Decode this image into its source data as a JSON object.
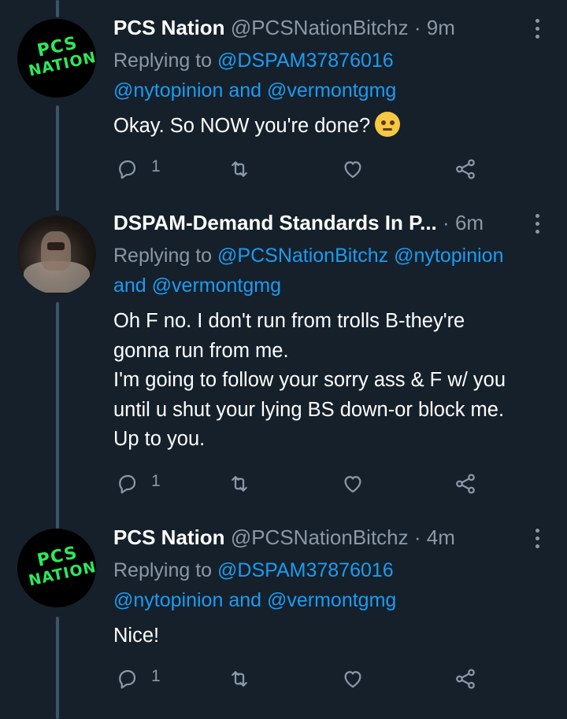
{
  "tweets": [
    {
      "name": "PCS Nation",
      "handle": "@PCSNationBitchz",
      "dot": "·",
      "time": "9m",
      "avatar_text": [
        "PCS",
        "NATION"
      ],
      "replying_prefix": "Replying to",
      "replying_mention1": "@DSPAM37876016",
      "replying_mention2": "@nytopinion",
      "replying_and": "and",
      "replying_mention3": "@vermontgmg",
      "text": "Okay. So NOW you're done?",
      "emoji": "rolling-eyes-emoji",
      "reply_count": "1"
    },
    {
      "name": "DSPAM-Demand Standards In P...",
      "dot": "·",
      "time": "6m",
      "replying_prefix": "Replying to",
      "replying_mention1": "@PCSNationBitchz",
      "replying_mention2": "@nytopinion",
      "replying_and": "and",
      "replying_mention3": "@vermontgmg",
      "text_lines": [
        "Oh F no. I don't run from trolls B-they're",
        "gonna run from me.",
        "I'm going to follow your sorry ass & F w/ you",
        "until u shut your lying BS down-or block me.",
        "Up to you."
      ],
      "reply_count": "1"
    },
    {
      "name": "PCS Nation",
      "handle": "@PCSNationBitchz",
      "dot": "·",
      "time": "4m",
      "avatar_text": [
        "PCS",
        "NATION"
      ],
      "replying_prefix": "Replying to",
      "replying_mention1": "@DSPAM37876016",
      "replying_mention2": "@nytopinion",
      "replying_and": "and",
      "replying_mention3": "@vermontgmg",
      "text": "Nice!",
      "reply_count": "1"
    }
  ],
  "colors": {
    "background": "#15202b",
    "text": "#ffffff",
    "secondary": "#8b98a5",
    "link": "#1d9bf0",
    "logo_green": "#2de85c",
    "thread_line": "#3d5466"
  },
  "icons": [
    "reply-icon",
    "retweet-icon",
    "like-icon",
    "share-icon",
    "more-options-icon"
  ]
}
